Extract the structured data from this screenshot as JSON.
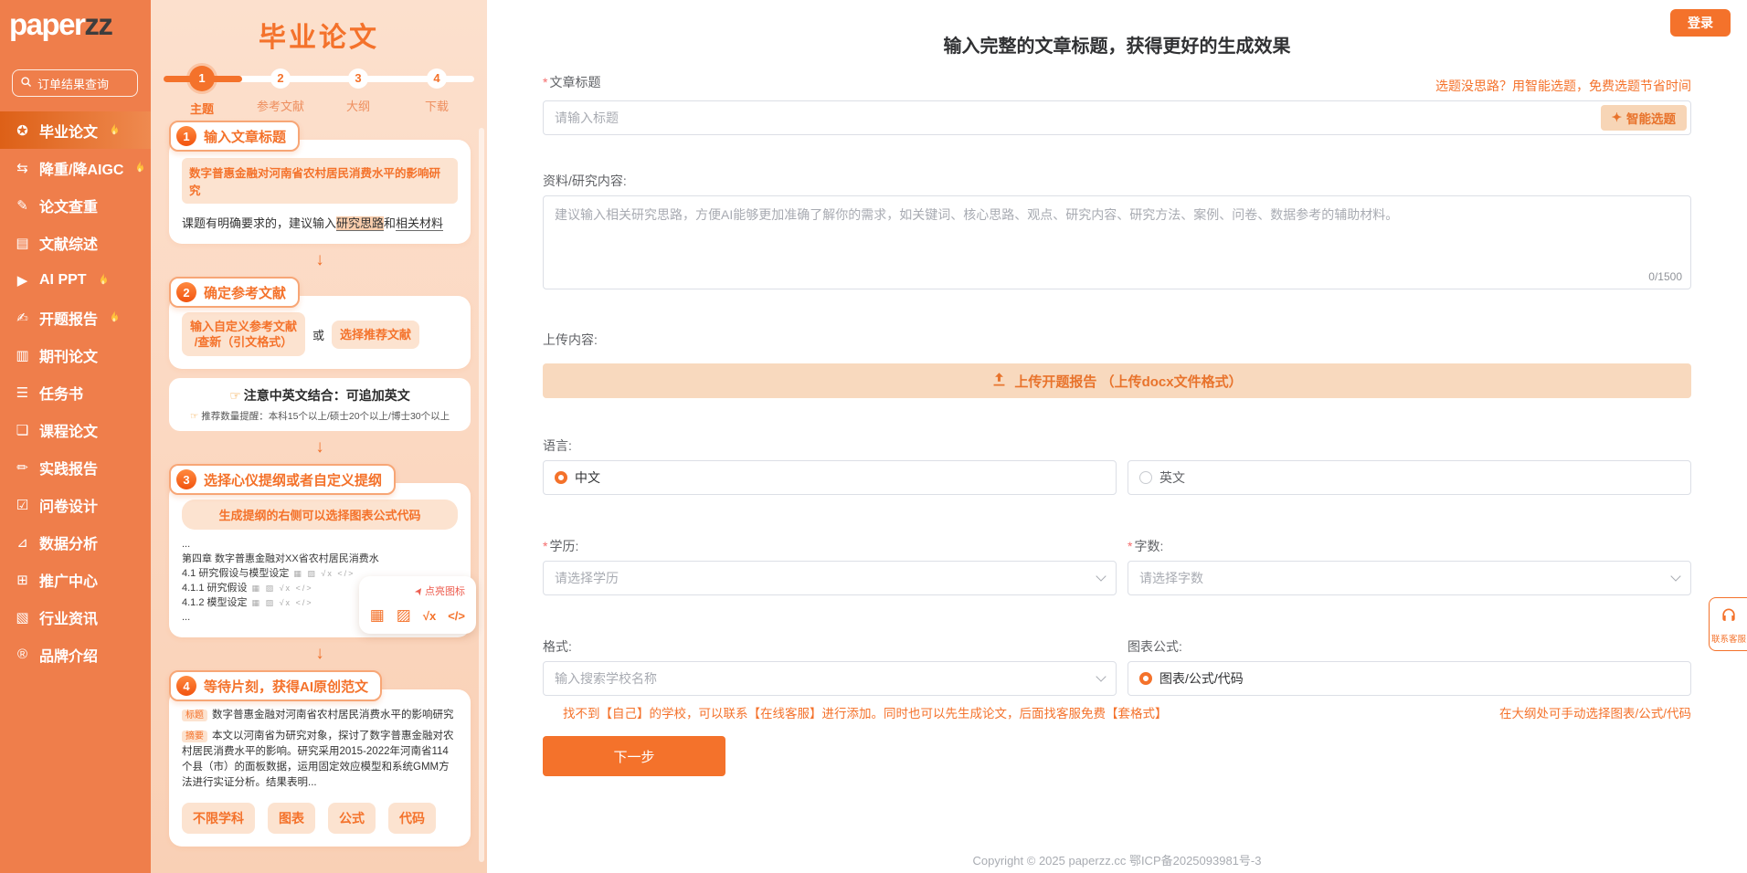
{
  "glyphs": {
    "sparkle": "✦",
    "arrow_down": "↓",
    "hand": "☞",
    "cursor": "➤",
    "table": "▦",
    "image": "▨",
    "formula": "√x",
    "code": "</>",
    "required": "*"
  },
  "sidebar": {
    "logo_primary": "paper",
    "logo_accent": "zz",
    "search_placeholder": "订单结果查询",
    "items": [
      {
        "icon": "✪",
        "label": "毕业论文",
        "hot": true,
        "active": true
      },
      {
        "icon": "⇆",
        "label": "降重/降AIGC",
        "hot": true
      },
      {
        "icon": "✎",
        "label": "论文查重"
      },
      {
        "icon": "▤",
        "label": "文献综述"
      },
      {
        "icon": "▶",
        "label": "AI PPT",
        "hot": true
      },
      {
        "icon": "✍",
        "label": "开题报告",
        "hot": true
      },
      {
        "icon": "▥",
        "label": "期刊论文"
      },
      {
        "icon": "☰",
        "label": "任务书"
      },
      {
        "icon": "❏",
        "label": "课程论文"
      },
      {
        "icon": "✏",
        "label": "实践报告"
      },
      {
        "icon": "☑",
        "label": "问卷设计"
      },
      {
        "icon": "⊿",
        "label": "数据分析"
      },
      {
        "icon": "⊞",
        "label": "推广中心"
      },
      {
        "icon": "▧",
        "label": "行业资讯"
      },
      {
        "icon": "®",
        "label": "品牌介绍"
      }
    ]
  },
  "wizard": {
    "title": "毕业论文",
    "steps": [
      {
        "num": "1",
        "label": "主题",
        "active": true
      },
      {
        "num": "2",
        "label": "参考文献"
      },
      {
        "num": "3",
        "label": "大纲"
      },
      {
        "num": "4",
        "label": "下载"
      }
    ],
    "step1": {
      "num": "1",
      "badge": "输入文章标题",
      "sample_title": "数字普惠金融对河南省农村居民消费水平的影响研究",
      "tip_prefix": "课题有明确要求的，建议输入",
      "tip_hl1": "研究思路",
      "tip_mid": "和",
      "tip_hl2": "相关材料"
    },
    "step2": {
      "num": "2",
      "badge": "确定参考文献",
      "option1_line1": "输入自定义参考文献",
      "option1_line2": "/查新（引文格式）",
      "or": "或",
      "option2": "选择推荐文献",
      "note1": "注意中英文结合：可追加英文",
      "note2": "推荐数量提醒：本科15个以上/硕士20个以上/博士30个以上"
    },
    "step3": {
      "num": "3",
      "badge": "选择心仪提纲或者自定义提纲",
      "pill": "生成提纲的右侧可以选择图表公式代码",
      "outline": [
        "...",
        "第四章 数字普惠金融对XX省农村居民消费水",
        "4.1 研究假设与模型设定",
        "4.1.1 研究假设",
        "4.1.2 模型设定",
        "..."
      ],
      "tooltip": "点亮图标"
    },
    "step4": {
      "num": "4",
      "badge": "等待片刻，获得AI原创范文",
      "title_tag": "标题",
      "title_text": "数字普惠金融对河南省农村居民消费水平的影响研究",
      "abstract_tag": "摘要",
      "abstract_text": "本文以河南省为研究对象，探讨了数字普惠金融对农村居民消费水平的影响。研究采用2015-2022年河南省114个县（市）的面板数据，运用固定效应模型和系统GMM方法进行实证分析。结果表明...",
      "tags": [
        "不限学科",
        "图表",
        "公式",
        "代码"
      ]
    }
  },
  "header": {
    "login_label": "登录",
    "title": "输入完整的文章标题，获得更好的生成效果"
  },
  "form": {
    "title_label": "文章标题",
    "title_placeholder": "请输入标题",
    "smart_btn": "智能选题",
    "smart_link": "选题没思路？用智能选题，免费选题节省时间",
    "content_label": "资料/研究内容:",
    "content_placeholder": "建议输入相关研究思路，方便AI能够更加准确了解你的需求，如关键词、核心思路、观点、研究内容、研究方法、案例、问卷、数据参考的辅助材料。",
    "counter": "0/1500",
    "upload_label": "上传内容:",
    "upload_btn": "上传开题报告 （上传docx文件格式）",
    "language_label": "语言:",
    "lang_zh": "中文",
    "lang_en": "英文",
    "degree_label": "学历:",
    "degree_placeholder": "请选择学历",
    "words_label": "字数:",
    "words_placeholder": "请选择字数",
    "format_label": "格式:",
    "format_placeholder": "输入搜索学校名称",
    "format_help": "找不到【自己】的学校，可以联系【在线客服】进行添加。同时也可以先生成论文，后面找客服免费【套格式】",
    "chart_label": "图表公式:",
    "chart_option": "图表/公式/代码",
    "chart_help": "在大纲处可手动选择图表/公式/代码",
    "next_btn": "下一步"
  },
  "footer": {
    "copyright": "Copyright © 2025 paperzz.cc 鄂ICP备2025093981号-3"
  },
  "support": {
    "label": "联系客服"
  }
}
